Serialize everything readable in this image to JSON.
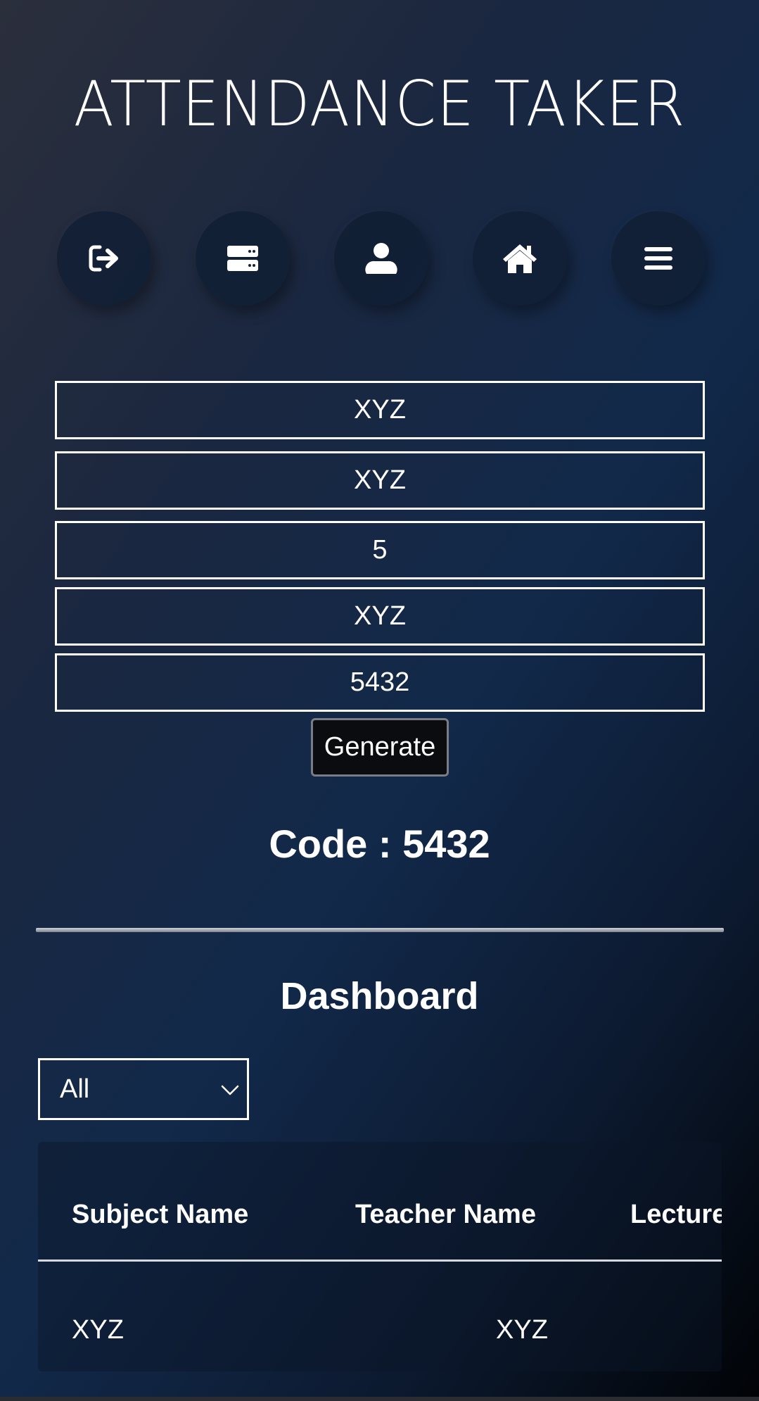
{
  "header": {
    "title": "ATTENDANCE TAKER"
  },
  "nav": {
    "buttons": [
      {
        "icon": "sign-out-icon"
      },
      {
        "icon": "server-icon"
      },
      {
        "icon": "user-icon"
      },
      {
        "icon": "home-icon"
      },
      {
        "icon": "menu-icon"
      }
    ]
  },
  "form": {
    "fields": [
      "XYZ",
      "XYZ",
      "5",
      "XYZ",
      "5432"
    ],
    "generate_label": "Generate"
  },
  "code": {
    "text": "Code : 5432"
  },
  "dashboard": {
    "title": "Dashboard",
    "filter": {
      "selected": "All"
    },
    "table": {
      "headers": [
        "Subject Name",
        "Teacher Name",
        "Lecture"
      ],
      "rows": [
        [
          "XYZ",
          "XYZ"
        ]
      ]
    }
  },
  "colors": {
    "text": "#ffffff",
    "button_bg": "#0a0c10",
    "nav_button_bg": "#101e34"
  }
}
